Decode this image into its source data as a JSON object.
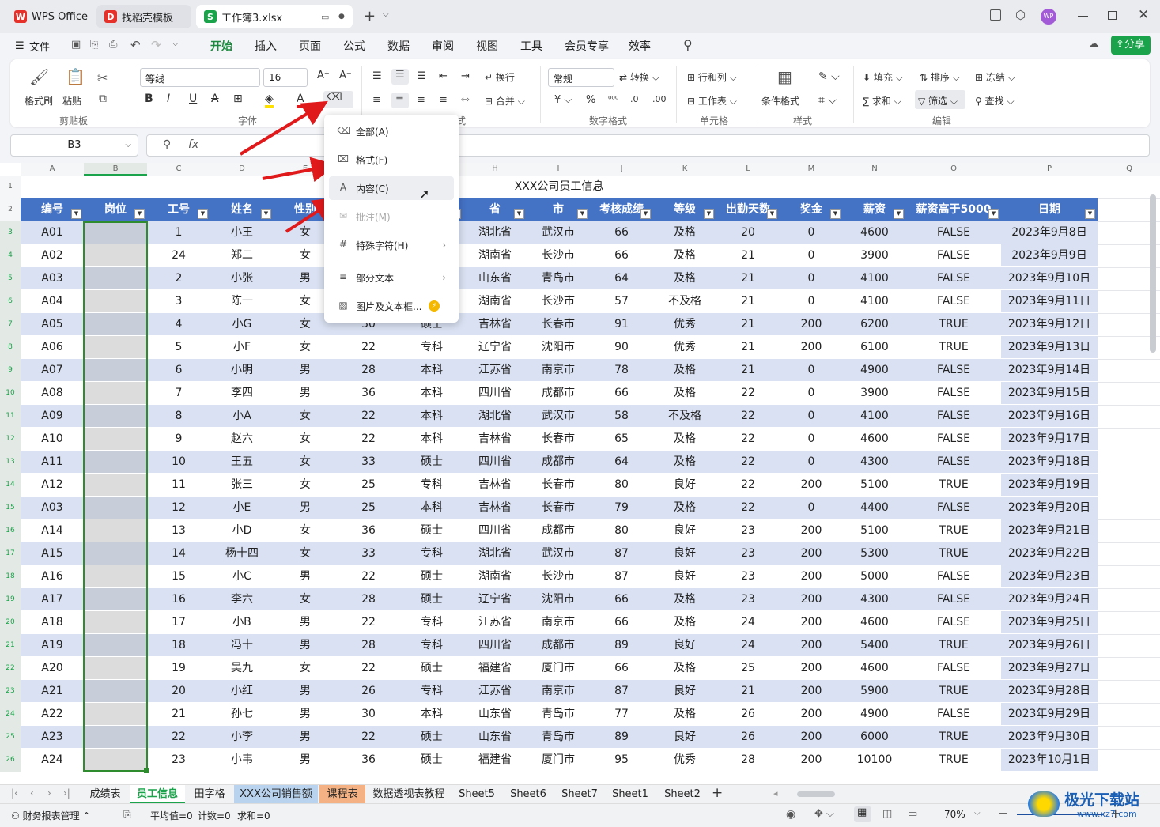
{
  "tabs": [
    {
      "label": "WPS Office"
    },
    {
      "label": "找稻壳模板"
    },
    {
      "label": "工作簿3.xlsx"
    }
  ],
  "menu": [
    "文件",
    "开始",
    "插入",
    "页面",
    "公式",
    "数据",
    "审阅",
    "视图",
    "工具",
    "会员专享",
    "效率"
  ],
  "share_label": "分享",
  "avatar": "WP",
  "ribbon": {
    "labels": {
      "format_painter": "格式刷",
      "paste": "粘贴",
      "font_name": "等线",
      "font_size": "16",
      "wrap": "换行",
      "merge": "合并",
      "number_format": "常规",
      "convert": "转换",
      "rows_cols": "行和列",
      "worksheet": "工作表",
      "cond_format": "条件格式",
      "fill": "填充",
      "sort": "排序",
      "freeze": "冻结",
      "sum": "求和",
      "filter": "筛选",
      "find": "查找"
    },
    "groups": [
      "剪贴板",
      "字体",
      "式",
      "数字格式",
      "单元格",
      "样式",
      "编辑"
    ]
  },
  "formula": {
    "cell_ref": "B3",
    "fx": "fx"
  },
  "columns": [
    "A",
    "B",
    "C",
    "D",
    "E",
    "F",
    "G",
    "H",
    "I",
    "J",
    "K",
    "L",
    "M",
    "N",
    "O",
    "P",
    "Q"
  ],
  "title": "XXX公司员工信息",
  "headers": [
    "编号",
    "岗位",
    "工号",
    "姓名",
    "性别",
    "",
    "",
    "省",
    "市",
    "考核成绩",
    "等级",
    "出勤天数",
    "奖金",
    "薪资",
    "薪资高于5000",
    "日期"
  ],
  "rows": [
    [
      "A01",
      "",
      "1",
      "小王",
      "女",
      "",
      "",
      "湖北省",
      "武汉市",
      "66",
      "及格",
      "20",
      "0",
      "4600",
      "FALSE",
      "2023年9月8日"
    ],
    [
      "A02",
      "",
      "24",
      "郑二",
      "女",
      "",
      "",
      "湖南省",
      "长沙市",
      "66",
      "及格",
      "21",
      "0",
      "3900",
      "FALSE",
      "2023年9月9日"
    ],
    [
      "A03",
      "",
      "2",
      "小张",
      "男",
      "",
      "",
      "山东省",
      "青岛市",
      "64",
      "及格",
      "21",
      "0",
      "4100",
      "FALSE",
      "2023年9月10日"
    ],
    [
      "A04",
      "",
      "3",
      "陈一",
      "女",
      "",
      "",
      "湖南省",
      "长沙市",
      "57",
      "不及格",
      "21",
      "0",
      "4100",
      "FALSE",
      "2023年9月11日"
    ],
    [
      "A05",
      "",
      "4",
      "小G",
      "女",
      "30",
      "硕士",
      "吉林省",
      "长春市",
      "91",
      "优秀",
      "21",
      "200",
      "6200",
      "TRUE",
      "2023年9月12日"
    ],
    [
      "A06",
      "",
      "5",
      "小F",
      "女",
      "22",
      "专科",
      "辽宁省",
      "沈阳市",
      "90",
      "优秀",
      "21",
      "200",
      "6100",
      "TRUE",
      "2023年9月13日"
    ],
    [
      "A07",
      "",
      "6",
      "小明",
      "男",
      "28",
      "本科",
      "江苏省",
      "南京市",
      "78",
      "及格",
      "21",
      "0",
      "4900",
      "FALSE",
      "2023年9月14日"
    ],
    [
      "A08",
      "",
      "7",
      "李四",
      "男",
      "36",
      "本科",
      "四川省",
      "成都市",
      "66",
      "及格",
      "22",
      "0",
      "3900",
      "FALSE",
      "2023年9月15日"
    ],
    [
      "A09",
      "",
      "8",
      "小A",
      "女",
      "22",
      "本科",
      "湖北省",
      "武汉市",
      "58",
      "不及格",
      "22",
      "0",
      "4100",
      "FALSE",
      "2023年9月16日"
    ],
    [
      "A10",
      "",
      "9",
      "赵六",
      "女",
      "22",
      "本科",
      "吉林省",
      "长春市",
      "65",
      "及格",
      "22",
      "0",
      "4600",
      "FALSE",
      "2023年9月17日"
    ],
    [
      "A11",
      "",
      "10",
      "王五",
      "女",
      "33",
      "硕士",
      "四川省",
      "成都市",
      "64",
      "及格",
      "22",
      "0",
      "4300",
      "FALSE",
      "2023年9月18日"
    ],
    [
      "A12",
      "",
      "11",
      "张三",
      "女",
      "25",
      "专科",
      "吉林省",
      "长春市",
      "80",
      "良好",
      "22",
      "200",
      "5100",
      "TRUE",
      "2023年9月19日"
    ],
    [
      "A03",
      "",
      "12",
      "小E",
      "男",
      "25",
      "本科",
      "吉林省",
      "长春市",
      "79",
      "及格",
      "22",
      "0",
      "4400",
      "FALSE",
      "2023年9月20日"
    ],
    [
      "A14",
      "",
      "13",
      "小D",
      "女",
      "36",
      "硕士",
      "四川省",
      "成都市",
      "80",
      "良好",
      "23",
      "200",
      "5100",
      "TRUE",
      "2023年9月21日"
    ],
    [
      "A15",
      "",
      "14",
      "杨十四",
      "女",
      "33",
      "专科",
      "湖北省",
      "武汉市",
      "87",
      "良好",
      "23",
      "200",
      "5300",
      "TRUE",
      "2023年9月22日"
    ],
    [
      "A16",
      "",
      "15",
      "小C",
      "男",
      "22",
      "硕士",
      "湖南省",
      "长沙市",
      "87",
      "良好",
      "23",
      "200",
      "5000",
      "FALSE",
      "2023年9月23日"
    ],
    [
      "A17",
      "",
      "16",
      "李六",
      "女",
      "28",
      "硕士",
      "辽宁省",
      "沈阳市",
      "66",
      "及格",
      "23",
      "200",
      "4300",
      "FALSE",
      "2023年9月24日"
    ],
    [
      "A18",
      "",
      "17",
      "小B",
      "男",
      "22",
      "专科",
      "江苏省",
      "南京市",
      "66",
      "及格",
      "24",
      "200",
      "4600",
      "FALSE",
      "2023年9月25日"
    ],
    [
      "A19",
      "",
      "18",
      "冯十",
      "男",
      "28",
      "专科",
      "四川省",
      "成都市",
      "89",
      "良好",
      "24",
      "200",
      "5400",
      "TRUE",
      "2023年9月26日"
    ],
    [
      "A20",
      "",
      "19",
      "吴九",
      "女",
      "22",
      "硕士",
      "福建省",
      "厦门市",
      "66",
      "及格",
      "25",
      "200",
      "4600",
      "FALSE",
      "2023年9月27日"
    ],
    [
      "A21",
      "",
      "20",
      "小红",
      "男",
      "26",
      "专科",
      "江苏省",
      "南京市",
      "87",
      "良好",
      "21",
      "200",
      "5900",
      "TRUE",
      "2023年9月28日"
    ],
    [
      "A22",
      "",
      "21",
      "孙七",
      "男",
      "30",
      "本科",
      "山东省",
      "青岛市",
      "77",
      "及格",
      "26",
      "200",
      "4900",
      "FALSE",
      "2023年9月29日"
    ],
    [
      "A23",
      "",
      "22",
      "小李",
      "男",
      "22",
      "硕士",
      "山东省",
      "青岛市",
      "89",
      "良好",
      "26",
      "200",
      "6000",
      "TRUE",
      "2023年9月30日"
    ],
    [
      "A24",
      "",
      "23",
      "小韦",
      "男",
      "36",
      "硕士",
      "福建省",
      "厦门市",
      "95",
      "优秀",
      "28",
      "200",
      "10100",
      "TRUE",
      "2023年10月1日"
    ]
  ],
  "context_menu": [
    {
      "label": "全部(A)",
      "disabled": false
    },
    {
      "label": "格式(F)",
      "disabled": false
    },
    {
      "label": "内容(C)",
      "disabled": false
    },
    {
      "label": "批注(M)",
      "disabled": true
    },
    {
      "label": "特殊字符(H)",
      "disabled": false
    },
    {
      "label": "部分文本",
      "disabled": false
    },
    {
      "label": "图片及文本框...",
      "disabled": false
    }
  ],
  "sheet_tabs": [
    "成绩表",
    "员工信息",
    "田字格",
    "XXX公司销售额",
    "课程表",
    "数据透视表教程",
    "Sheet5",
    "Sheet6",
    "Sheet7",
    "Sheet1",
    "Sheet2"
  ],
  "status": {
    "workspace": "财务报表管理",
    "avg": "平均值=0",
    "count": "计数=0",
    "sum": "求和=0",
    "zoom": "70%"
  },
  "watermark": {
    "brand": "极光下载站",
    "url": "www.xz7.com"
  },
  "colors": {
    "header_blue": "#4472c4",
    "band": "#d9e1f2",
    "arrow": "#e0191b",
    "accent_green": "#1aa34a"
  }
}
